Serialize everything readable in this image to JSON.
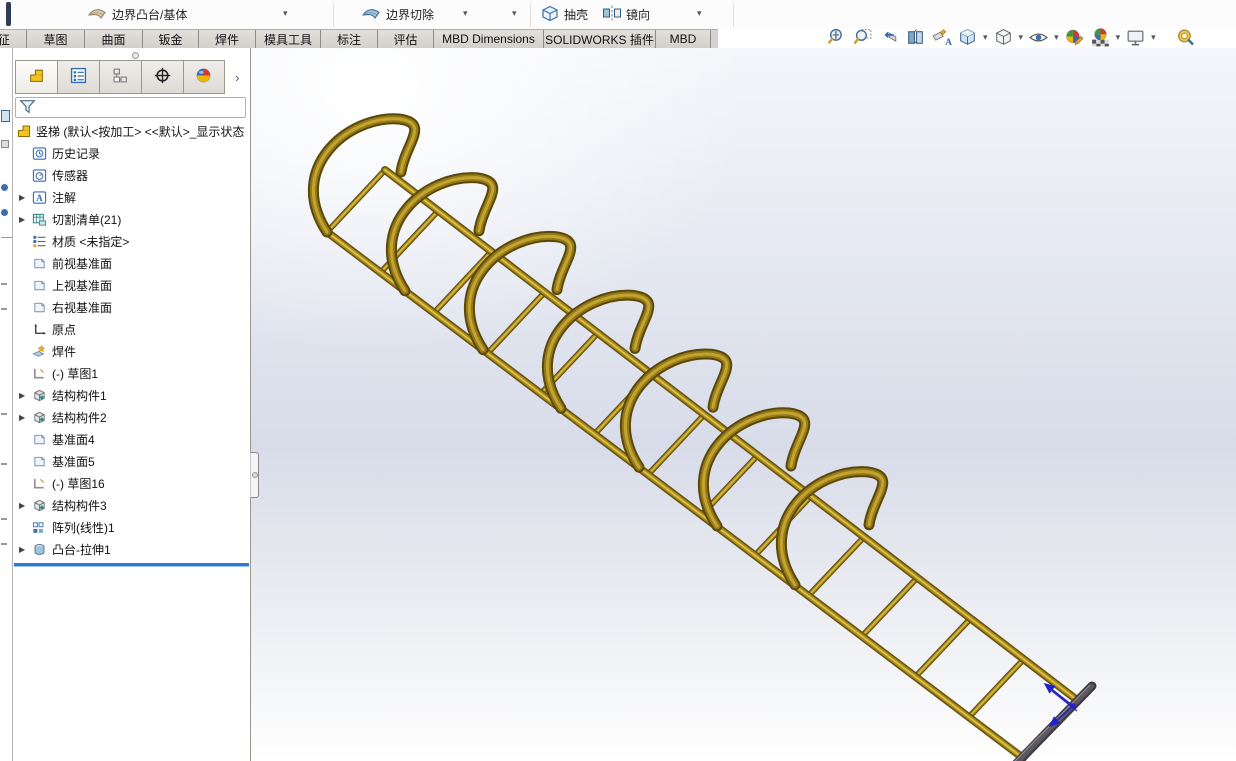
{
  "app": {
    "name": "SOLIDWORKS",
    "document": "竖梯"
  },
  "toolbar": {
    "buttons": [
      {
        "label": "边界凸台/基体",
        "icon": "boundary-boss"
      },
      {
        "label": "边界切除",
        "icon": "boundary-cut"
      },
      {
        "label": "抽壳",
        "icon": "shell"
      },
      {
        "label": "镜向",
        "icon": "mirror"
      }
    ]
  },
  "command_tabs": [
    {
      "label": "特征"
    },
    {
      "label": "草图"
    },
    {
      "label": "曲面"
    },
    {
      "label": "钣金"
    },
    {
      "label": "焊件"
    },
    {
      "label": "模具工具"
    },
    {
      "label": "标注"
    },
    {
      "label": "评估"
    },
    {
      "label": "MBD Dimensions"
    },
    {
      "label": "SOLIDWORKS 插件"
    },
    {
      "label": "MBD"
    }
  ],
  "headsup": {
    "icons": [
      "zoom-to-fit",
      "zoom-to-area",
      "previous-view",
      "section-view",
      "dynamic-annotation-views",
      "view-orientation",
      "display-style",
      "hide-show-items",
      "edit-appearance",
      "apply-scene",
      "view-settings",
      "magnify"
    ]
  },
  "panel_tabs": [
    "featuremanager",
    "propertymanager",
    "configurationmanager",
    "dimxpertmanager",
    "displaymanager"
  ],
  "feature_tree": {
    "filter_value": "",
    "root": {
      "label": "竖梯 (默认<按加工> <<默认>_显示状态",
      "icon": "part"
    },
    "items": [
      {
        "label": "历史记录",
        "icon": "history",
        "expandable": false
      },
      {
        "label": "传感器",
        "icon": "sensors",
        "expandable": false
      },
      {
        "label": "注解",
        "icon": "annotations",
        "expandable": true
      },
      {
        "label": "切割清单(21)",
        "icon": "cut-list",
        "expandable": true
      },
      {
        "label": "材质 <未指定>",
        "icon": "material",
        "expandable": false
      },
      {
        "label": "前视基准面",
        "icon": "plane",
        "expandable": false
      },
      {
        "label": "上视基准面",
        "icon": "plane",
        "expandable": false
      },
      {
        "label": "右视基准面",
        "icon": "plane",
        "expandable": false
      },
      {
        "label": "原点",
        "icon": "origin",
        "expandable": false
      },
      {
        "label": "焊件",
        "icon": "weldment",
        "expandable": false
      },
      {
        "label": "(-) 草图1",
        "icon": "sketch",
        "expandable": false
      },
      {
        "label": "结构构件1",
        "icon": "structural-member",
        "expandable": true
      },
      {
        "label": "结构构件2",
        "icon": "structural-member",
        "expandable": true
      },
      {
        "label": "基准面4",
        "icon": "plane",
        "expandable": false
      },
      {
        "label": "基准面5",
        "icon": "plane",
        "expandable": false
      },
      {
        "label": "(-) 草图16",
        "icon": "sketch",
        "expandable": false
      },
      {
        "label": "结构构件3",
        "icon": "structural-member",
        "expandable": true
      },
      {
        "label": "阵列(线性)1",
        "icon": "linear-pattern",
        "expandable": false
      },
      {
        "label": "凸台-拉伸1",
        "icon": "boss-extrude",
        "expandable": true
      }
    ],
    "rollback_color": "#2b7bd4"
  },
  "viewport": {
    "model_name": "竖梯 (caged vertical ladder weldment)",
    "colors": {
      "model_gold": "#b3942a",
      "model_gold_dark": "#66520f",
      "model_gold_light": "#d9bf45",
      "base_bar": "#46414a",
      "origin_marker": "#2222cc",
      "background_mid": "#d8dce9"
    }
  }
}
